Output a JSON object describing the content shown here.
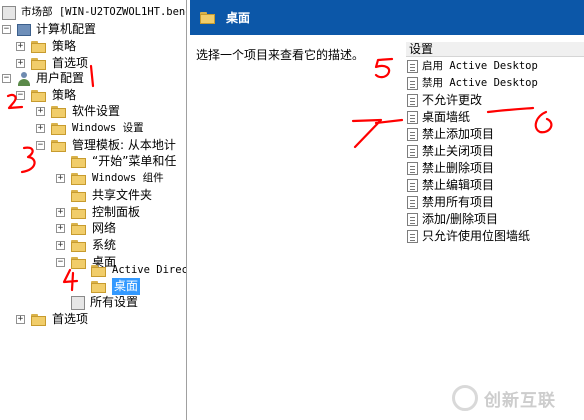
{
  "tree": {
    "items": [
      {
        "label": "市场部 [WIN-U2TOZWOL1HT.bene",
        "icon": "settings-icon",
        "expander": "",
        "mono": false
      },
      {
        "label": "计算机配置",
        "icon": "computer-icon",
        "expander": "−",
        "mono": false
      },
      {
        "label": "策略",
        "icon": "folder-icon",
        "expander": "+",
        "mono": false
      },
      {
        "label": "首选项",
        "icon": "folder-icon",
        "expander": "+",
        "mono": false
      },
      {
        "label": "用户配置",
        "icon": "user-icon",
        "expander": "−",
        "mono": false
      },
      {
        "label": "策略",
        "icon": "folder-icon",
        "expander": "−",
        "mono": false
      },
      {
        "label": "软件设置",
        "icon": "folder-icon",
        "expander": "+",
        "mono": false
      },
      {
        "label": "Windows 设置",
        "icon": "folder-icon",
        "expander": "+",
        "mono": true
      },
      {
        "label": "管理模板: 从本地计",
        "icon": "folder-icon",
        "expander": "−",
        "mono": false
      },
      {
        "label": "“开始”菜单和任",
        "icon": "folder-icon",
        "expander": "",
        "mono": false
      },
      {
        "label": "Windows 组件",
        "icon": "folder-icon",
        "expander": "+",
        "mono": true
      },
      {
        "label": "共享文件夹",
        "icon": "folder-icon",
        "expander": "",
        "mono": false
      },
      {
        "label": "控制面板",
        "icon": "folder-icon",
        "expander": "+",
        "mono": false
      },
      {
        "label": "网络",
        "icon": "folder-icon",
        "expander": "+",
        "mono": false
      },
      {
        "label": "系统",
        "icon": "folder-icon",
        "expander": "+",
        "mono": false
      },
      {
        "label": "桌面",
        "icon": "folder-icon",
        "expander": "−",
        "mono": false
      },
      {
        "label": "Active Direc",
        "icon": "folder-icon",
        "expander": "",
        "mono": true
      },
      {
        "label": "桌面",
        "icon": "folder-icon",
        "expander": "",
        "mono": false,
        "selected": true
      },
      {
        "label": "所有设置",
        "icon": "settings-icon",
        "expander": "",
        "mono": false
      },
      {
        "label": "首选项",
        "icon": "folder-icon",
        "expander": "+",
        "mono": false
      }
    ]
  },
  "header": {
    "title": "桌面"
  },
  "description": "选择一个项目来查看它的描述。",
  "list": {
    "column": "设置",
    "items": [
      {
        "label": "启用 Active Desktop",
        "mono": true
      },
      {
        "label": "禁用 Active Desktop",
        "mono": true
      },
      {
        "label": "不允许更改",
        "mono": false
      },
      {
        "label": "桌面墙纸",
        "mono": false
      },
      {
        "label": "禁止添加项目",
        "mono": false
      },
      {
        "label": "禁止关闭项目",
        "mono": false
      },
      {
        "label": "禁止删除项目",
        "mono": false
      },
      {
        "label": "禁止编辑项目",
        "mono": false
      },
      {
        "label": "禁用所有项目",
        "mono": false
      },
      {
        "label": "添加/删除项目",
        "mono": false
      },
      {
        "label": "只允许使用位图墙纸",
        "mono": false
      }
    ]
  },
  "annotations": {
    "color": "#ff0000"
  },
  "watermark": {
    "text": "创新互联"
  },
  "colors": {
    "header_bg": "#0c57a8",
    "selection": "#3399ff"
  }
}
